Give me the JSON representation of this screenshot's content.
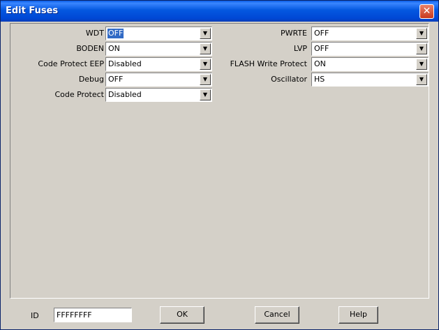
{
  "window": {
    "title": "Edit Fuses",
    "close_glyph": "✕"
  },
  "fuses_left": [
    {
      "label": "WDT",
      "value": "OFF"
    },
    {
      "label": "BODEN",
      "value": "ON"
    },
    {
      "label": "Code Protect EEP",
      "value": "Disabled"
    },
    {
      "label": "Debug",
      "value": "OFF"
    },
    {
      "label": "Code Protect",
      "value": "Disabled"
    }
  ],
  "fuses_right": [
    {
      "label": "PWRTE",
      "value": "OFF"
    },
    {
      "label": "LVP",
      "value": "OFF"
    },
    {
      "label": "FLASH Write Protect",
      "value": "ON"
    },
    {
      "label": "Oscillator",
      "value": "HS"
    }
  ],
  "dropdown_arrow_glyph": "▼",
  "footer": {
    "id_label": "ID",
    "id_value": "FFFFFFFF",
    "ok_label": "OK",
    "cancel_label": "Cancel",
    "help_label": "Help"
  }
}
